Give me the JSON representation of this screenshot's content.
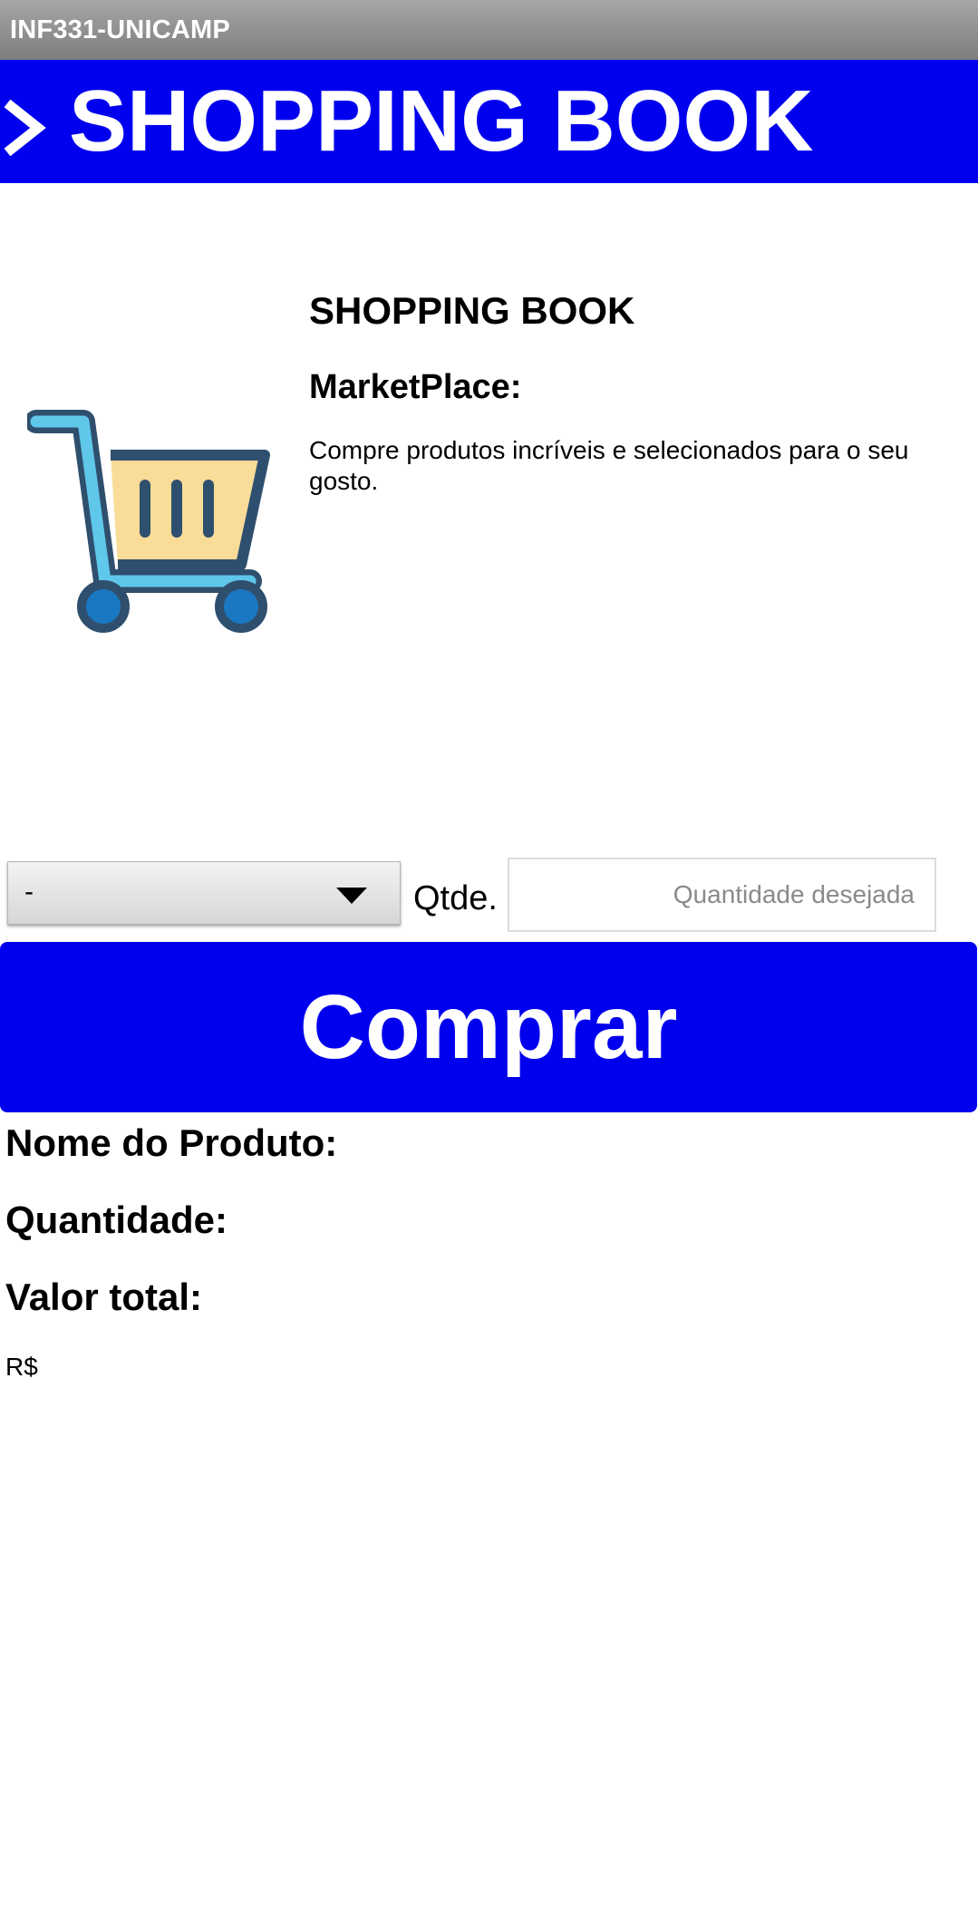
{
  "titlebar": {
    "title": "INF331-UNICAMP"
  },
  "header": {
    "title": "SHOPPING BOOK",
    "icon": "chevron-right-icon"
  },
  "product_card": {
    "icon": "shopping-cart-icon",
    "title": "SHOPPING BOOK",
    "subtitle": "MarketPlace:",
    "description": "Compre produtos incríveis e selecionados para o seu gosto."
  },
  "order_form": {
    "product_select": {
      "selected_value": "-",
      "icon": "dropdown-arrow-icon"
    },
    "quantity_label": "Qtde.",
    "quantity_input": {
      "value": "",
      "placeholder": "Quantidade desejada"
    },
    "buy_button_label": "Comprar"
  },
  "summary": {
    "product_name_label": "Nome do Produto:",
    "quantity_label": "Quantidade:",
    "total_label": "Valor total:",
    "total_value": "R$"
  },
  "colors": {
    "header_background": "#0000ee",
    "button_background": "#0000ee",
    "titlebar_background": "#8c8c8c"
  }
}
